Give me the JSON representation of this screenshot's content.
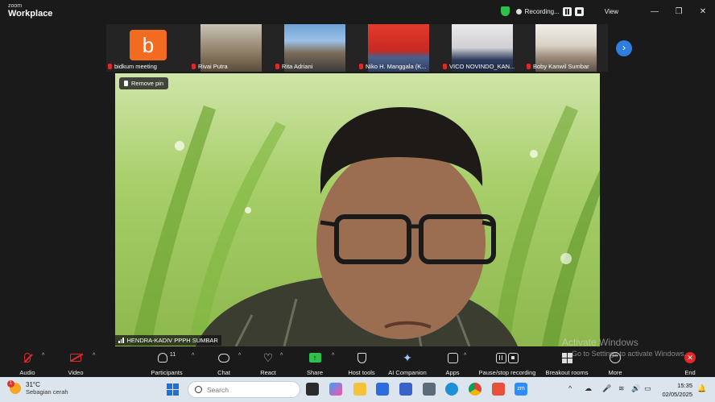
{
  "app": {
    "brand_top": "zoom",
    "brand_bottom": "Workplace"
  },
  "titlebar": {
    "recording_label": "Recording...",
    "view_label": "View",
    "window_controls": [
      "minimize-icon",
      "restore-icon",
      "close-icon"
    ]
  },
  "participants_strip": [
    {
      "name": "bidkum meeting",
      "avatar_letter": "b",
      "avatar_color": "#f26b21"
    },
    {
      "name": "Rivai Putra"
    },
    {
      "name": "Rita Adriani"
    },
    {
      "name": "Niko H. Manggala (K..."
    },
    {
      "name": "VICO NOVINDO_KAN..."
    },
    {
      "name": "Boby Kanwil Sumbar"
    }
  ],
  "main_video": {
    "remove_pin_label": "Remove pin",
    "speaker_name": "HENDRA-KADIV PPPH SUMBAR"
  },
  "watermark": {
    "line1": "Activate Windows",
    "line2": "Go to Settings to activate Windows."
  },
  "toolbar": {
    "audio": "Audio",
    "video": "Video",
    "participants": "Participants",
    "participants_count": "11",
    "chat": "Chat",
    "react": "React",
    "share": "Share",
    "host_tools": "Host tools",
    "ai_companion": "AI Companion",
    "apps": "Apps",
    "pause_stop": "Pause/stop recording",
    "breakout": "Breakout rooms",
    "more": "More",
    "end": "End"
  },
  "taskbar": {
    "weather_temp": "31°C",
    "weather_cond": "Sebagian cerah",
    "weather_badge": "1",
    "search_placeholder": "Search",
    "time": "15:35",
    "date": "02/05/2025"
  },
  "colors": {
    "accent": "#2f7de1",
    "record_green": "#2fbf4a",
    "muted_red": "#e02828"
  }
}
